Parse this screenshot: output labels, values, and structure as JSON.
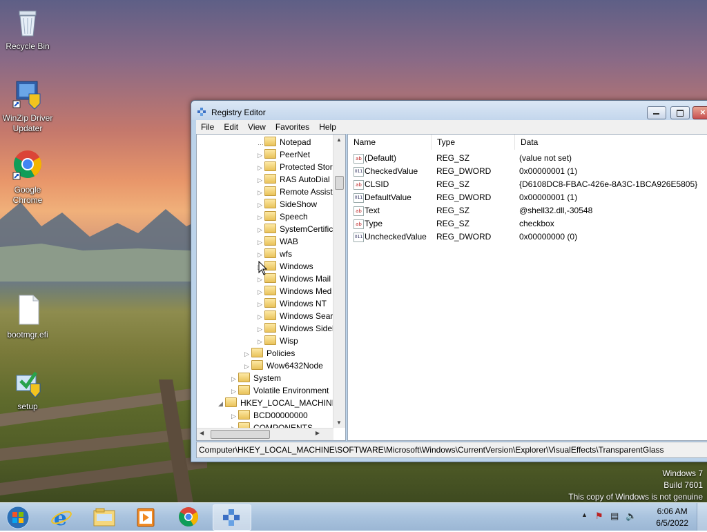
{
  "desktop": {
    "icons": [
      {
        "label": "Recycle Bin"
      },
      {
        "label": "WinZip Driver Updater"
      },
      {
        "label": "Google Chrome"
      },
      {
        "label": "bootmgr.efi"
      },
      {
        "label": "setup"
      }
    ],
    "watermark": {
      "line1": "Windows 7",
      "line2": "Build 7601",
      "line3": "This copy of Windows is not genuine"
    }
  },
  "window": {
    "title": "Registry Editor",
    "menu": [
      "File",
      "Edit",
      "View",
      "Favorites",
      "Help"
    ],
    "tree": [
      {
        "label": "Notepad",
        "expander": "…"
      },
      {
        "label": "PeerNet",
        "expander": "▷"
      },
      {
        "label": "Protected Stor",
        "expander": "▷"
      },
      {
        "label": "RAS AutoDial",
        "expander": "▷"
      },
      {
        "label": "Remote Assista",
        "expander": "▷"
      },
      {
        "label": "SideShow",
        "expander": "▷"
      },
      {
        "label": "Speech",
        "expander": "▷"
      },
      {
        "label": "SystemCertific",
        "expander": "▷"
      },
      {
        "label": "WAB",
        "expander": "▷"
      },
      {
        "label": "wfs",
        "expander": "▷"
      },
      {
        "label": "Windows",
        "expander": "▷"
      },
      {
        "label": "Windows Mail",
        "expander": "▷"
      },
      {
        "label": "Windows Med",
        "expander": "▷"
      },
      {
        "label": "Windows NT",
        "expander": "▷"
      },
      {
        "label": "Windows Sear",
        "expander": "▷"
      },
      {
        "label": "Windows Sidel",
        "expander": "▷"
      },
      {
        "label": "Wisp",
        "expander": "▷"
      },
      {
        "label": "Policies",
        "expander": "▷"
      },
      {
        "label": "Wow6432Node",
        "expander": "▷"
      },
      {
        "label": "System",
        "expander": "▷"
      },
      {
        "label": "Volatile Environment",
        "expander": "▷"
      },
      {
        "label": "HKEY_LOCAL_MACHINE",
        "expander": "◢"
      },
      {
        "label": "BCD00000000",
        "expander": "▷"
      },
      {
        "label": "COMPONENTS",
        "expander": "▷"
      }
    ],
    "columns": {
      "name": "Name",
      "type": "Type",
      "data": "Data"
    },
    "values": [
      {
        "icon": "ab",
        "name": "(Default)",
        "type": "REG_SZ",
        "data": "(value not set)"
      },
      {
        "icon": "dword",
        "name": "CheckedValue",
        "type": "REG_DWORD",
        "data": "0x00000001 (1)"
      },
      {
        "icon": "ab",
        "name": "CLSID",
        "type": "REG_SZ",
        "data": "{D6108DC8-FBAC-426e-8A3C-1BCA926E5805}"
      },
      {
        "icon": "dword",
        "name": "DefaultValue",
        "type": "REG_DWORD",
        "data": "0x00000001 (1)"
      },
      {
        "icon": "ab",
        "name": "Text",
        "type": "REG_SZ",
        "data": "@shell32.dll,-30548"
      },
      {
        "icon": "ab",
        "name": "Type",
        "type": "REG_SZ",
        "data": "checkbox"
      },
      {
        "icon": "dword",
        "name": "UncheckedValue",
        "type": "REG_DWORD",
        "data": "0x00000000 (0)"
      }
    ],
    "status_path": "Computer\\HKEY_LOCAL_MACHINE\\SOFTWARE\\Microsoft\\Windows\\CurrentVersion\\Explorer\\VisualEffects\\TransparentGlass"
  },
  "taskbar": {
    "pinned": [
      "start-orb-icon",
      "internet-explorer-icon",
      "windows-explorer-icon",
      "media-player-icon",
      "chrome-icon",
      "registry-editor-icon"
    ],
    "clock": {
      "time": "6:06 AM",
      "date": "6/5/2022"
    },
    "tray_icons": [
      "show-hidden-icons-chevron",
      "action-center-flag-icon",
      "network-icon",
      "volume-icon"
    ]
  },
  "icon_glyphs": {
    "ab": "ab",
    "dword": "011"
  }
}
